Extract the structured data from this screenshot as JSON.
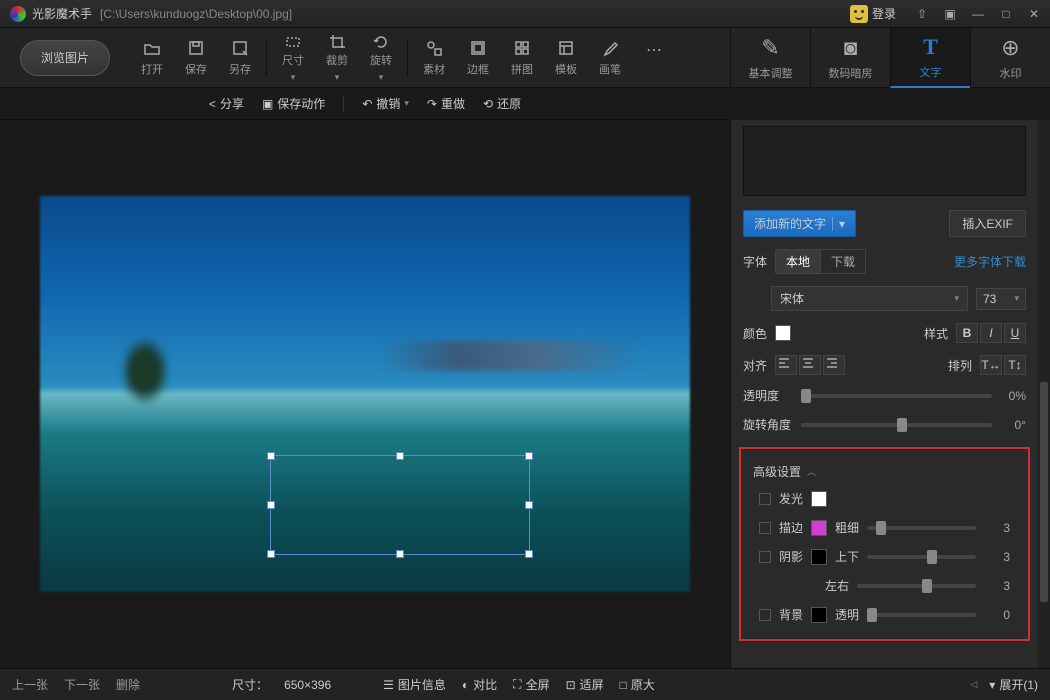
{
  "title": {
    "app": "光影魔术手",
    "path": "[C:\\Users\\kunduogz\\Desktop\\00.jpg]"
  },
  "login_label": "登录",
  "browse_label": "浏览图片",
  "toolbar": [
    {
      "label": "打开"
    },
    {
      "label": "保存"
    },
    {
      "label": "另存"
    },
    {
      "label": "尺寸"
    },
    {
      "label": "裁剪"
    },
    {
      "label": "旋转"
    },
    {
      "label": "素材"
    },
    {
      "label": "边框"
    },
    {
      "label": "拼图"
    },
    {
      "label": "模板"
    },
    {
      "label": "画笔"
    },
    {
      "label": "..."
    }
  ],
  "right_tabs": [
    {
      "label": "基本调整"
    },
    {
      "label": "数码暗房"
    },
    {
      "label": "文字"
    },
    {
      "label": "水印"
    }
  ],
  "actions": {
    "share": "分享",
    "save_act": "保存动作",
    "undo": "撤销",
    "redo": "重做",
    "restore": "还原"
  },
  "text_panel": {
    "add_text": "添加新的文字",
    "insert_exif": "插入EXIF",
    "font_label": "字体",
    "local": "本地",
    "download": "下载",
    "more_fonts": "更多字体下载",
    "font_family": "宋体",
    "font_size": "73",
    "color_label": "颜色",
    "style_label": "样式",
    "bold": "B",
    "italic": "I",
    "underline": "U",
    "align_label": "对齐",
    "arrange_label": "排列",
    "opacity_label": "透明度",
    "opacity_val": "0%",
    "rotate_label": "旋转角度",
    "rotate_val": "0°",
    "adv_label": "高级设置",
    "glow": "发光",
    "stroke": "描边",
    "stroke_size": "粗细",
    "stroke_val": "3",
    "shadow": "阴影",
    "shadow_v": "上下",
    "shadow_v_val": "3",
    "shadow_h": "左右",
    "shadow_h_val": "3",
    "bg": "背景",
    "bg_op": "透明",
    "bg_val": "0"
  },
  "status": {
    "prev": "上一张",
    "next": "下一张",
    "delete": "删除",
    "size_label": "尺寸：",
    "size_val": "650×396",
    "info": "图片信息",
    "compare": "对比",
    "fullscreen": "全屏",
    "fit": "适屏",
    "actual": "原大",
    "expand": "展开(1)"
  }
}
